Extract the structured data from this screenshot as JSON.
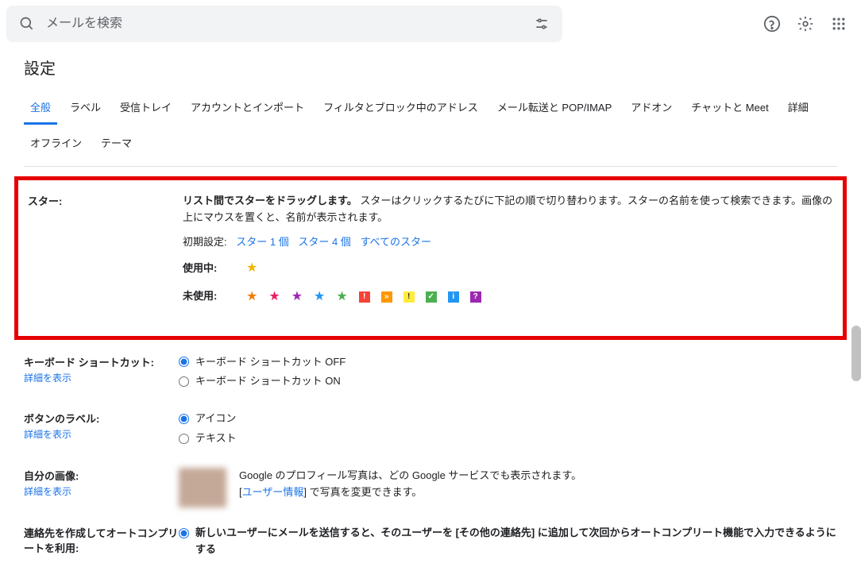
{
  "search": {
    "placeholder": "メールを検索"
  },
  "title": "設定",
  "tabs": [
    "全般",
    "ラベル",
    "受信トレイ",
    "アカウントとインポート",
    "フィルタとブロック中のアドレス",
    "メール転送と POP/IMAP",
    "アドオン",
    "チャットと Meet",
    "詳細"
  ],
  "tabs2": [
    "オフライン",
    "テーマ"
  ],
  "stars": {
    "label": "スター:",
    "desc_bold": "リスト間でスターをドラッグします。",
    "desc": " スターはクリックするたびに下記の順で切り替わります。スターの名前を使って検索できます。画像の上にマウスを置くと、名前が表示されます。",
    "preset_label": "初期設定:",
    "presets": [
      "スター 1 個",
      "スター 4 個",
      "すべてのスター"
    ],
    "inuse_label": "使用中:",
    "unused_label": "未使用:"
  },
  "keyboard": {
    "label": "キーボード ショートカット:",
    "detail": "詳細を表示",
    "off": "キーボード ショートカット OFF",
    "on": "キーボード ショートカット ON"
  },
  "button_labels": {
    "label": "ボタンのラベル:",
    "detail": "詳細を表示",
    "icon": "アイコン",
    "text": "テキスト"
  },
  "profile": {
    "label": "自分の画像:",
    "detail": "詳細を表示",
    "text1": "Google のプロフィール写真は、どの Google サービスでも表示されます。",
    "link": "ユーザー情報",
    "text2": " で写真を変更できます。"
  },
  "autocomplete": {
    "label": "連絡先を作成してオートコンプリートを利用:",
    "opt1": "新しいユーザーにメールを送信すると、そのユーザーを [その他の連絡先] に追加して次回からオートコンプリート機能で入力できるようにする"
  }
}
